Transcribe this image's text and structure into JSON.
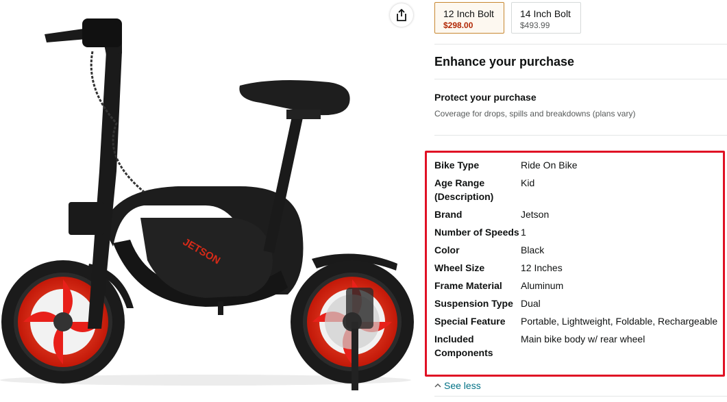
{
  "variants": [
    {
      "name": "12 Inch Bolt",
      "price": "$298.00",
      "selected": true
    },
    {
      "name": "14 Inch Bolt",
      "price": "$493.99",
      "selected": false
    }
  ],
  "enhance": {
    "title": "Enhance your purchase",
    "protect_title": "Protect your purchase",
    "protect_subtitle": "Coverage for drops, spills and breakdowns (plans vary)"
  },
  "specs": [
    {
      "label": "Bike Type",
      "value": "Ride On Bike"
    },
    {
      "label": "Age Range (Description)",
      "value": "Kid"
    },
    {
      "label": "Brand",
      "value": "Jetson"
    },
    {
      "label": "Number of Speeds",
      "value": "1"
    },
    {
      "label": "Color",
      "value": "Black"
    },
    {
      "label": "Wheel Size",
      "value": "12 Inches"
    },
    {
      "label": "Frame Material",
      "value": "Aluminum"
    },
    {
      "label": "Suspension Type",
      "value": "Dual"
    },
    {
      "label": "Special Feature",
      "value": "Portable, Lightweight, Foldable, Rechargeable"
    },
    {
      "label": "Included Components",
      "value": "Main bike body w/ rear wheel"
    }
  ],
  "see_less": {
    "label": "See less"
  },
  "product_image": {
    "logo_text": "JETSON"
  },
  "icons": {
    "share": "share-icon",
    "see_less": "chevron-up-icon"
  },
  "colors": {
    "selected_border": "#c7862f",
    "price_red": "#b12704",
    "link": "#007185",
    "highlight": "#e01024",
    "wheel_red": "#e8201a"
  }
}
